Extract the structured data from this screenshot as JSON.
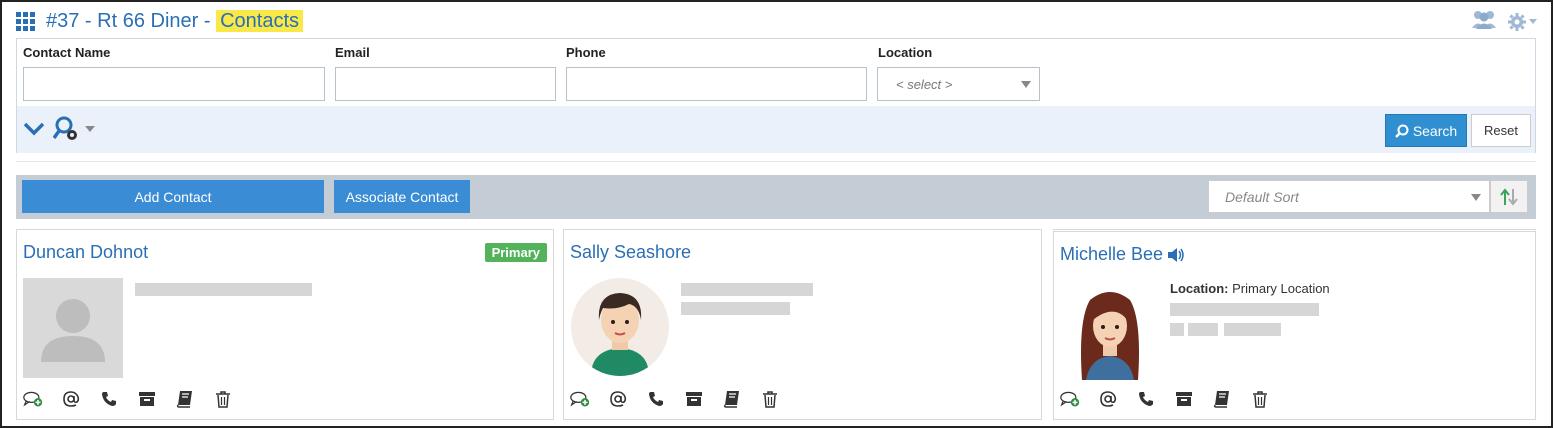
{
  "header": {
    "title_prefix": "#37 - Rt 66 Diner - ",
    "title_highlight": "Contacts"
  },
  "filters": {
    "contact_name_label": "Contact Name",
    "email_label": "Email",
    "phone_label": "Phone",
    "location_label": "Location",
    "location_placeholder": "< select >",
    "search_label": "Search",
    "reset_label": "Reset"
  },
  "actions": {
    "add_label": "Add Contact",
    "associate_label": "Associate Contact",
    "sort_placeholder": "Default Sort"
  },
  "contacts": [
    {
      "name": "Duncan Dohnot",
      "badge": "Primary"
    },
    {
      "name": "Sally Seashore"
    },
    {
      "name": "Michelle Bee",
      "location_label": "Location:",
      "location_value": "Primary Location"
    }
  ],
  "colors": {
    "accent": "#2a6fb5",
    "button": "#3a8cd4",
    "primary_badge": "#52b35a"
  }
}
